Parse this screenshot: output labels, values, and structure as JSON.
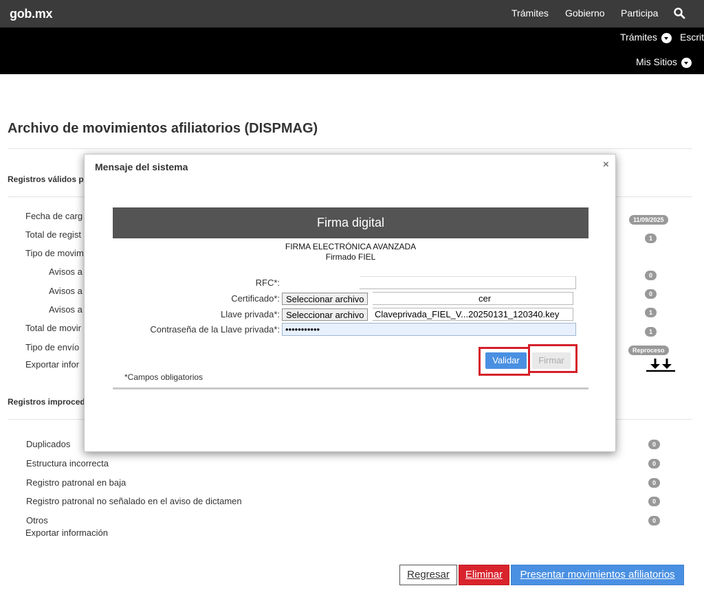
{
  "header": {
    "logo": "gob.mx",
    "nav": [
      "Trámites",
      "Gobierno",
      "Participa"
    ]
  },
  "subnav": {
    "tramites": "Trámites",
    "escritorio": "Escrit",
    "mis_sitios": "Mis Sitios"
  },
  "page": {
    "title": "Archivo de movimientos afiliatorios (DISPMAG)",
    "valid_section": "Registros válidos p",
    "rows": [
      {
        "label": "Fecha de carg",
        "badge": "11/09/2025"
      },
      {
        "label": "Total de regist",
        "badge": "1"
      },
      {
        "label": "Tipo de movim",
        "badge": ""
      },
      {
        "label": "Avisos a",
        "badge": "0"
      },
      {
        "label": "Avisos a",
        "badge": "0"
      },
      {
        "label": "Avisos a",
        "badge": "1"
      },
      {
        "label": "Total de movir",
        "badge": "1"
      },
      {
        "label": "Tipo de envío",
        "badge": "Reproceso"
      },
      {
        "label": "Exportar infor",
        "badge": ""
      }
    ],
    "improcedentes_section": "Registros improced",
    "improcedentes": [
      {
        "label": "Duplicados",
        "badge": "0"
      },
      {
        "label": "Estructura incorrecta",
        "badge": "0"
      },
      {
        "label": "Registro patronal en baja",
        "badge": "0"
      },
      {
        "label": "Registro patronal no señalado en el aviso de dictamen",
        "badge": "0"
      },
      {
        "label": "Otros",
        "badge": "0"
      }
    ],
    "export_label": "Exportar información"
  },
  "buttons": {
    "regresar": "Regresar",
    "eliminar": "Eliminar",
    "presentar": "Presentar movimientos afiliatorios"
  },
  "modal": {
    "title": "Mensaje del sistema",
    "close": "×",
    "panel_header": "Firma digital",
    "fiel_title": "FIRMA ELECTRÓNICA AVANZADA",
    "fiel_subtitle": "Firmado FIEL",
    "rfc_label": "RFC*:",
    "cert_label": "Certificado*:",
    "key_label": "Llave privada*:",
    "pwd_label": "Contraseña de la Llave privada*:",
    "file_button": "Seleccionar archivo",
    "cert_value": "cer",
    "key_value": "Claveprivada_FIEL_V...20250131_120340.key",
    "pwd_value": "•••••••••••",
    "validar": "Validar",
    "firmar": "Firmar",
    "required_note": "*Campos obligatorios"
  },
  "colors": {
    "topbar": "#3b3b3b",
    "subbar": "#000000",
    "accent_blue": "#4a90e2",
    "danger_red": "#d9232d",
    "panel_header": "#545454",
    "highlight": "#d4202a"
  }
}
